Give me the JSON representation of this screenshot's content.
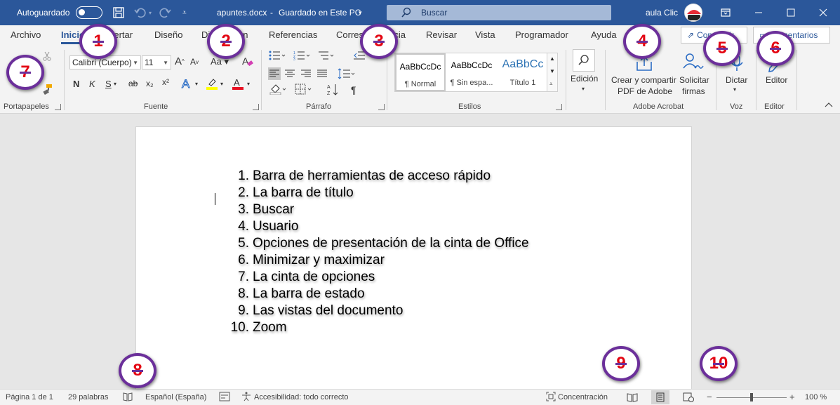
{
  "titlebar": {
    "autosave_label": "Autoguardado",
    "document_title": "apuntes.docx",
    "separator": "-",
    "save_status": "Guardado en Este PC",
    "search_placeholder": "Buscar",
    "user_name": "aula Clic",
    "avatar_text": "aula Clic"
  },
  "tabs": [
    {
      "label": "Archivo"
    },
    {
      "label": "Inicio"
    },
    {
      "label": "Insertar"
    },
    {
      "label": "Diseño"
    },
    {
      "label": "Disposición"
    },
    {
      "label": "Referencias"
    },
    {
      "label": "Correspondencia"
    },
    {
      "label": "Revisar"
    },
    {
      "label": "Vista"
    },
    {
      "label": "Programador"
    },
    {
      "label": "Ayuda"
    }
  ],
  "share": {
    "share_label": "Compartir",
    "comments_label": "Comentarios"
  },
  "ribbon": {
    "groups": {
      "portapapeles": "Portapapeles",
      "fuente": "Fuente",
      "parrafo": "Párrafo",
      "estilos": "Estilos",
      "adobe": "Adobe Acrobat",
      "voz": "Voz",
      "editor": "Editor"
    },
    "font_name": "Calibri (Cuerpo)",
    "font_size": "11",
    "bold": "N",
    "italic": "K",
    "underline": "S",
    "strikethrough": "ab",
    "subscript": "x₂",
    "superscript": "x²",
    "styles": [
      {
        "sample": "AaBbCcDc",
        "name": "¶ Normal"
      },
      {
        "sample": "AaBbCcDc",
        "name": "¶ Sin espa..."
      },
      {
        "sample": "AaBbCc",
        "name": "Título 1"
      }
    ],
    "edicion_label": "Edición",
    "adobe_create_line1": "Crear y compartir",
    "adobe_create_line2": "PDF de Adobe",
    "adobe_sign_line1": "Solicitar",
    "adobe_sign_line2": "firmas",
    "dictar_label": "Dictar",
    "editor_label": "Editor"
  },
  "document": {
    "items": [
      {
        "num": "1.",
        "text": "Barra de herramientas de acceso rápido"
      },
      {
        "num": "2.",
        "text": "La barra de título"
      },
      {
        "num": "3.",
        "text": "Buscar"
      },
      {
        "num": "4.",
        "text": "Usuario"
      },
      {
        "num": "5.",
        "text": "Opciones de presentación de la cinta de Office"
      },
      {
        "num": "6.",
        "text": "Minimizar y maximizar"
      },
      {
        "num": "7.",
        "text": "La cinta de opciones"
      },
      {
        "num": "8.",
        "text": "La barra de estado"
      },
      {
        "num": "9.",
        "text": "Las vistas del documento"
      },
      {
        "num": "10.",
        "text": "Zoom"
      }
    ]
  },
  "statusbar": {
    "page": "Página 1 de 1",
    "words": "29 palabras",
    "language": "Español (España)",
    "accessibility": "Accesibilidad: todo correcto",
    "focus": "Concentración",
    "zoom_minus": "−",
    "zoom_plus": "+",
    "zoom": "100 %",
    "zoom_level_percent": 100
  },
  "callouts": [
    "1",
    "2",
    "3",
    "4",
    "5",
    "6",
    "7",
    "8",
    "9",
    "10"
  ],
  "colors": {
    "titlebar": "#2b579a",
    "callout_border": "#6b2f9a",
    "callout_text": "#e30613"
  }
}
